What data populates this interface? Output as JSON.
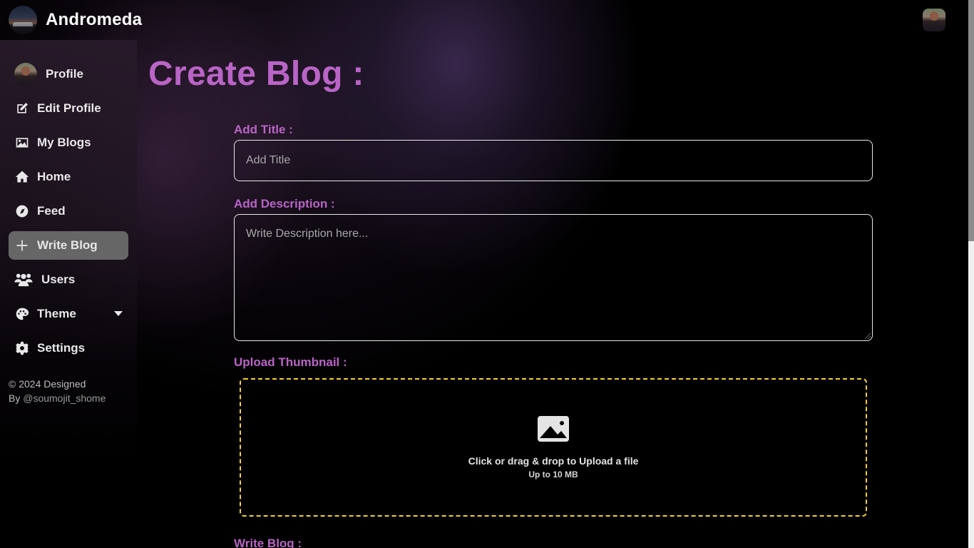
{
  "app": {
    "name": "Andromeda"
  },
  "sidebar": {
    "items": [
      {
        "label": "Profile",
        "icon": "avatar"
      },
      {
        "label": "Edit Profile",
        "icon": "edit-icon"
      },
      {
        "label": "My Blogs",
        "icon": "image-icon"
      },
      {
        "label": "Home",
        "icon": "home-icon"
      },
      {
        "label": "Feed",
        "icon": "compass-icon"
      },
      {
        "label": "Write Blog",
        "icon": "plus-icon",
        "active": true
      },
      {
        "label": "Users",
        "icon": "users-icon"
      },
      {
        "label": "Theme",
        "icon": "palette-icon",
        "has_dropdown": true
      },
      {
        "label": "Settings",
        "icon": "gear-icon"
      }
    ],
    "footer": {
      "line1": "© 2024 Designed",
      "by": "By ",
      "handle": "@soumojit_shome"
    }
  },
  "main": {
    "title": "Create Blog :",
    "form": {
      "title_label": "Add Title :",
      "title_placeholder": "Add Title",
      "title_value": "",
      "description_label": "Add Description :",
      "description_placeholder": "Write Description here...",
      "description_value": "",
      "thumbnail_label": "Upload Thumbnail :",
      "upload_text": "Click or drag & drop to Upload a file",
      "upload_limit": "Up to 10 MB",
      "write_blog_label": "Write Blog :"
    }
  },
  "colors": {
    "accent": "#b964c6",
    "dropzone_border": "#f5d12a",
    "active_nav_bg": "#666666"
  }
}
